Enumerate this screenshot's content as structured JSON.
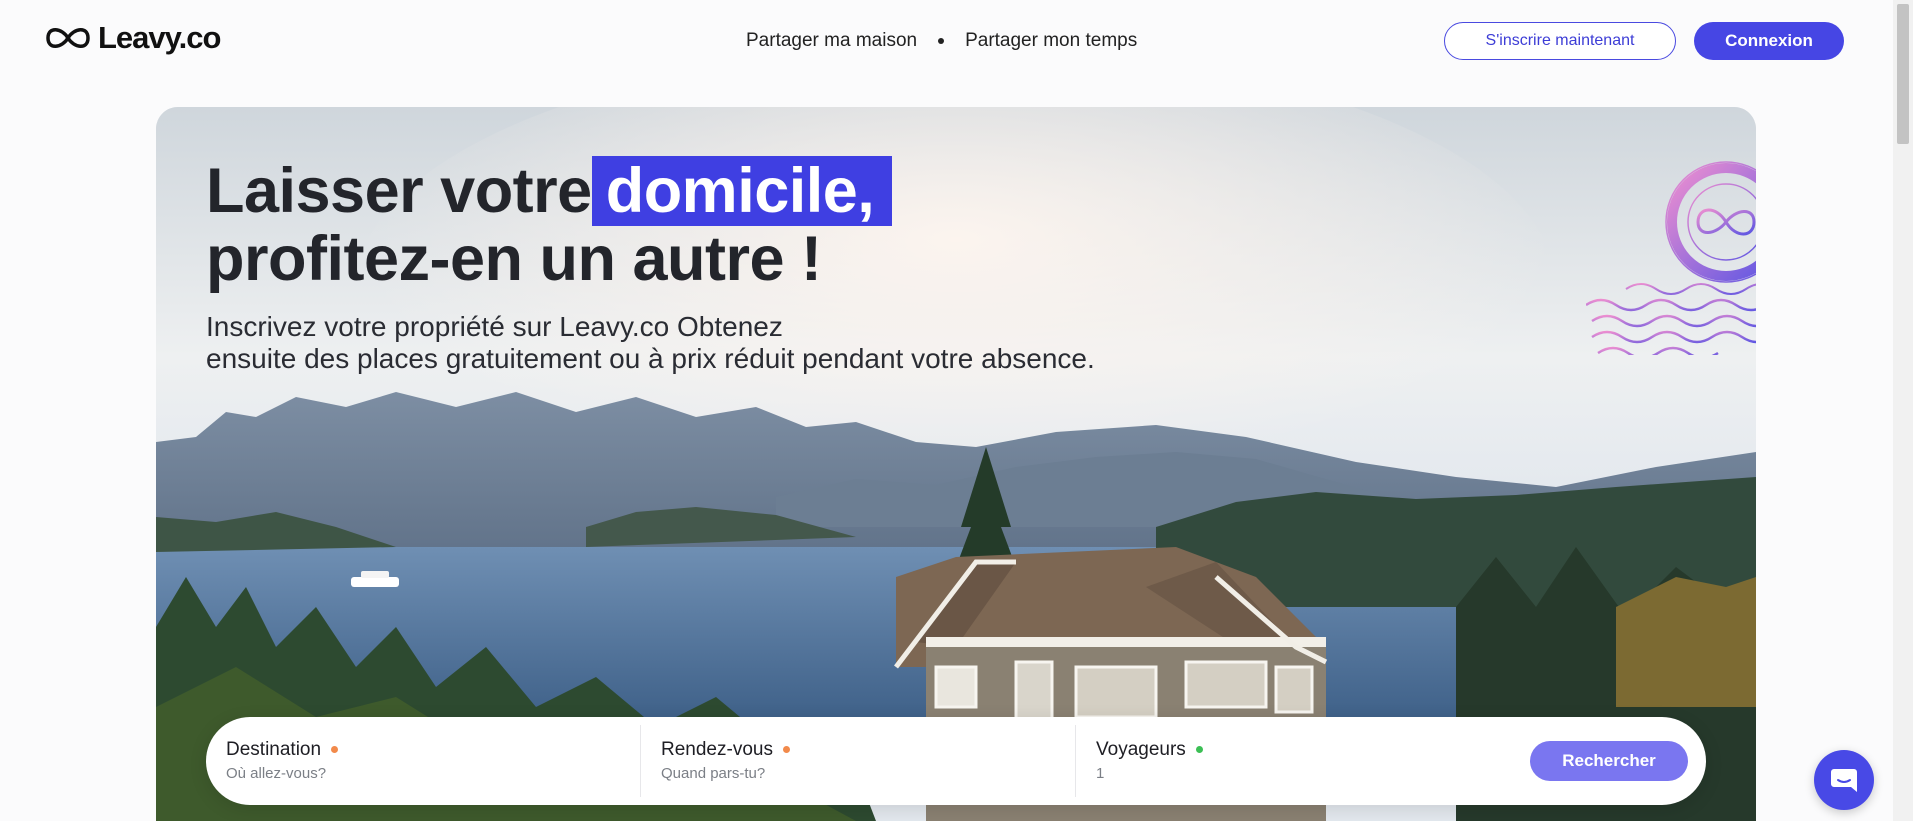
{
  "brand": {
    "name": "Leavy.co"
  },
  "nav": {
    "items": [
      "Partager ma maison",
      "Partager mon temps"
    ]
  },
  "auth": {
    "signup_label": "S'inscrire maintenant",
    "login_label": "Connexion"
  },
  "hero": {
    "headline_part1": "Laisser votre",
    "headline_highlight": "domicile,",
    "headline_part2": "profitez-en un autre !",
    "subtitle_line1": "Inscrivez votre propriété sur Leavy.co Obtenez",
    "subtitle_line2": "ensuite des places gratuitement ou à prix réduit pendant votre absence."
  },
  "search": {
    "destination": {
      "label": "Destination",
      "placeholder": "Où allez-vous?",
      "dot_color": "#f28a4b"
    },
    "date": {
      "label": "Rendez-vous",
      "placeholder": "Quand pars-tu?",
      "dot_color": "#f28a4b"
    },
    "travelers": {
      "label": "Voyageurs",
      "value": "1",
      "dot_color": "#3cbf55"
    },
    "button_label": "Rechercher"
  },
  "colors": {
    "accent": "#4646e4",
    "button_light": "#7a76f0"
  },
  "icons": {
    "logo": "infinity-icon",
    "stamp": "postmark-icon",
    "chat": "chat-bubble-icon"
  }
}
